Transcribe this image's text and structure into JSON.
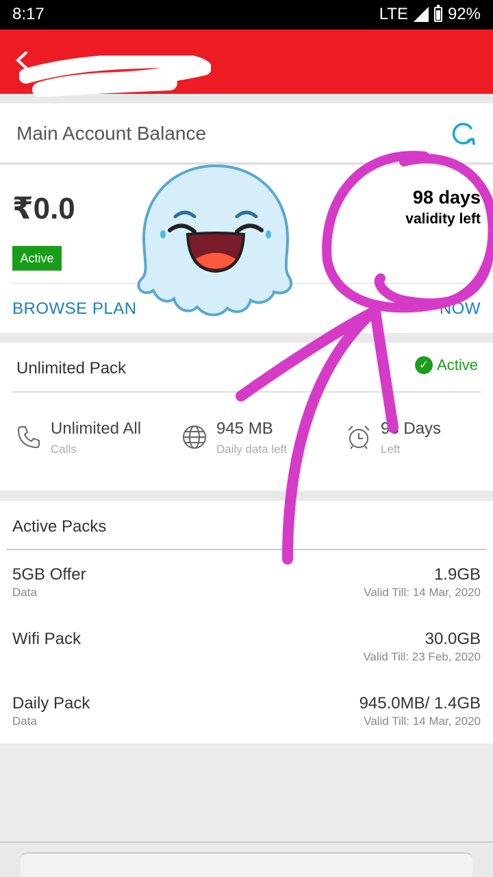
{
  "status_bar": {
    "time": "8:17",
    "network": "LTE",
    "battery": "92%"
  },
  "balance": {
    "title": "Main Account Balance",
    "amount": "₹0.0",
    "status": "Active",
    "validity_days": "98 days",
    "validity_label": "validity left",
    "browse_label": "BROWSE PLAN",
    "recharge_label": "NOW"
  },
  "unlimited_pack": {
    "title": "Unlimited Pack",
    "status": "Active",
    "stats": [
      {
        "main": "Unlimited All",
        "sub": "Calls",
        "icon": "phone-icon"
      },
      {
        "main": "945 MB",
        "sub": "Daily data left",
        "icon": "globe-icon"
      },
      {
        "main": "98 Days",
        "sub": "Left",
        "icon": "alarm-clock-icon"
      }
    ]
  },
  "active_packs": {
    "title": "Active Packs",
    "items": [
      {
        "name": "5GB Offer",
        "type": "Data",
        "amount": "1.9GB",
        "valid": "Valid Till: 14 Mar, 2020"
      },
      {
        "name": "Wifi Pack",
        "type": "",
        "amount": "30.0GB",
        "valid": "Valid Till: 23 Feb, 2020"
      },
      {
        "name": "Daily Pack",
        "type": "Data",
        "amount": "945.0MB/ 1.4GB",
        "valid": "Valid Till: 14 Mar, 2020"
      }
    ]
  },
  "colors": {
    "brand_red": "#ed1c24",
    "link_blue": "#1a7fc1",
    "active_green": "#1a9e1a",
    "annotation_magenta": "#d63bc8"
  }
}
